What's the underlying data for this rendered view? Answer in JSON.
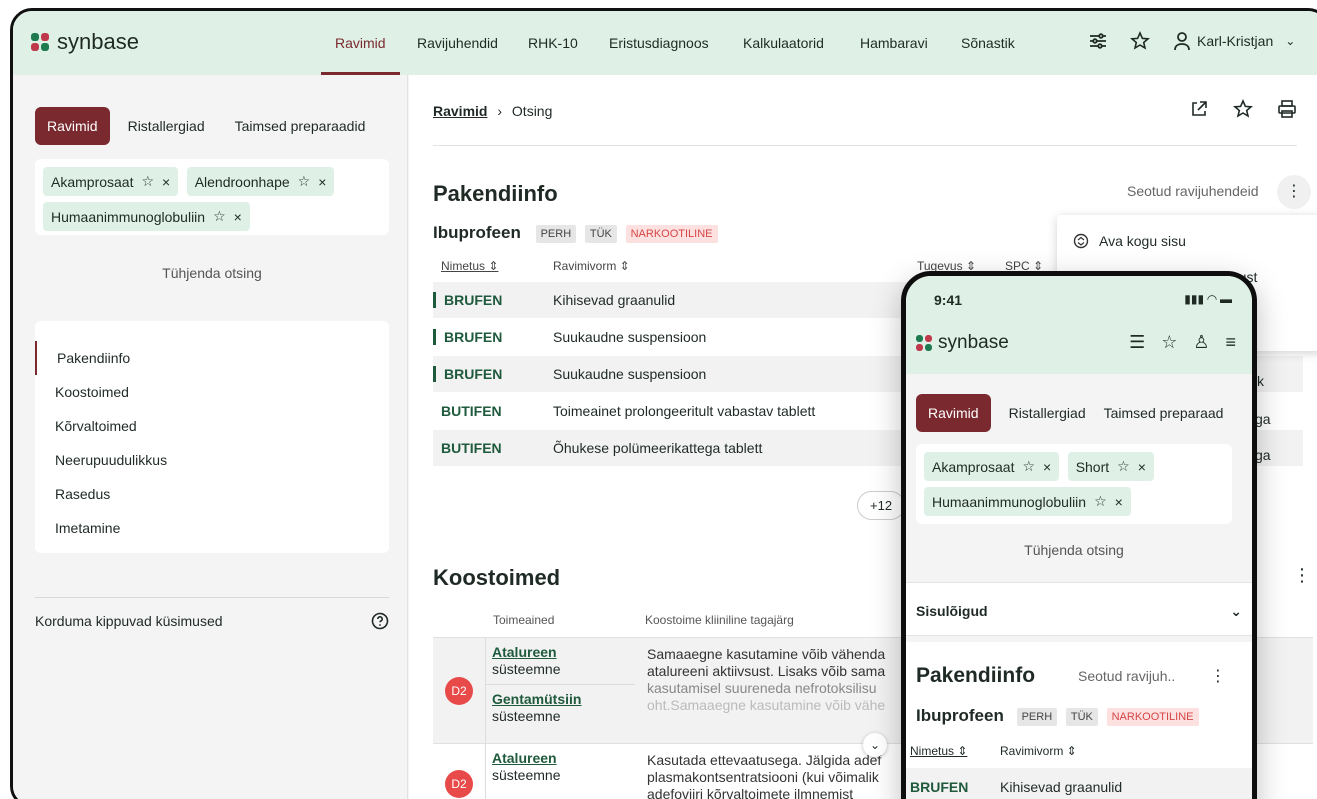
{
  "brand": "synbase",
  "nav": [
    "Ravimid",
    "Ravijuhendid",
    "RHK-10",
    "Eristusdiagnoos",
    "Kalkulaatorid",
    "Hambaravi",
    "Sõnastik"
  ],
  "user_name": "Karl-Kristjan",
  "left": {
    "tabs": [
      "Ravimid",
      "Ristallergiad",
      "Taimsed preparaadid"
    ],
    "tags": [
      "Akamprosaat",
      "Alendroonhape",
      "Humaanimmunoglobuliin"
    ],
    "clear": "Tühjenda otsing",
    "toc": [
      "Pakendiinfo",
      "Koostoimed",
      "Kõrvaltoimed",
      "Neerupuudulikkus",
      "Rasedus",
      "Imetamine"
    ],
    "faq": "Korduma kippuvad küsimused"
  },
  "breadcrumb": {
    "link": "Ravimid",
    "sep": "›",
    "current": "Otsing"
  },
  "pakendiinfo": {
    "title": "Pakendiinfo",
    "related": "Seotud ravijuhendeid",
    "drug": "Ibuprofeen",
    "badges": [
      "PERH",
      "TÜK",
      "NARKOOTILINE"
    ],
    "columns": [
      "Nimetus",
      "Ravimivorm",
      "Tugevus",
      "SPC"
    ],
    "rows": [
      {
        "name": "BRUFEN",
        "form": "Kihisevad graanulid"
      },
      {
        "name": "BRUFEN",
        "form": "Suukaudne suspensioon"
      },
      {
        "name": "BRUFEN",
        "form": "Suukaudne suspensioon"
      },
      {
        "name": "BUTIFEN",
        "form": "Toimeainet prolongeeritult vabastav tablett"
      },
      {
        "name": "BUTIFEN",
        "form": "Õhukese polümeerikattega tablett"
      }
    ],
    "more": "+12",
    "menu": [
      "Ava kogu sisu",
      "...ust"
    ],
    "side_fragments": [
      "k",
      "ga",
      "ga"
    ]
  },
  "koostoimed": {
    "title": "Koostoimed",
    "columns": [
      "Toimeained",
      "Koostoime kliiniline tagajärg"
    ],
    "groups": [
      {
        "level": "D2",
        "substances": [
          {
            "name": "Atalureen",
            "route": "süsteemne"
          },
          {
            "name": "Gentamütsiin",
            "route": "süsteemne"
          }
        ],
        "effect": [
          "Samaaegne kasutamine võib vähenda",
          "atalureeni aktiivsust. Lisaks võib sama",
          "kasutamisel suureneda nefrotoksilisu",
          "oht.Samaaegne kasutamine võib vähe"
        ]
      },
      {
        "level": "D2",
        "substances": [
          {
            "name": "Atalureen",
            "route": "süsteemne"
          }
        ],
        "effect": [
          "Kasutada ettevaatusega. Jälgida adef",
          "plasmakontsentratsiooni (kui võimalik",
          "adefoviiri kõrvaltoimete ilmnemist"
        ]
      }
    ]
  },
  "phone": {
    "time": "9:41",
    "tabs": [
      "Ravimid",
      "Ristallergiad",
      "Taimsed preparaad"
    ],
    "tags": [
      "Akamprosaat",
      "Short",
      "Humaanimmunoglobuliin"
    ],
    "clear": "Tühjenda otsing",
    "sisu": "Sisulõigud",
    "title": "Pakendiinfo",
    "related": "Seotud ravijuh..",
    "drug": "Ibuprofeen",
    "badges": [
      "PERH",
      "TÜK",
      "NARKOOTILINE"
    ],
    "columns": [
      "Nimetus",
      "Ravimivorm"
    ],
    "row": {
      "name": "BRUFEN",
      "form": "Kihisevad graanulid"
    }
  },
  "colors": {
    "accent": "#7a2a2f",
    "mint": "#dff1e6",
    "green_text": "#1f5a3d",
    "danger": "#e84a4a"
  }
}
